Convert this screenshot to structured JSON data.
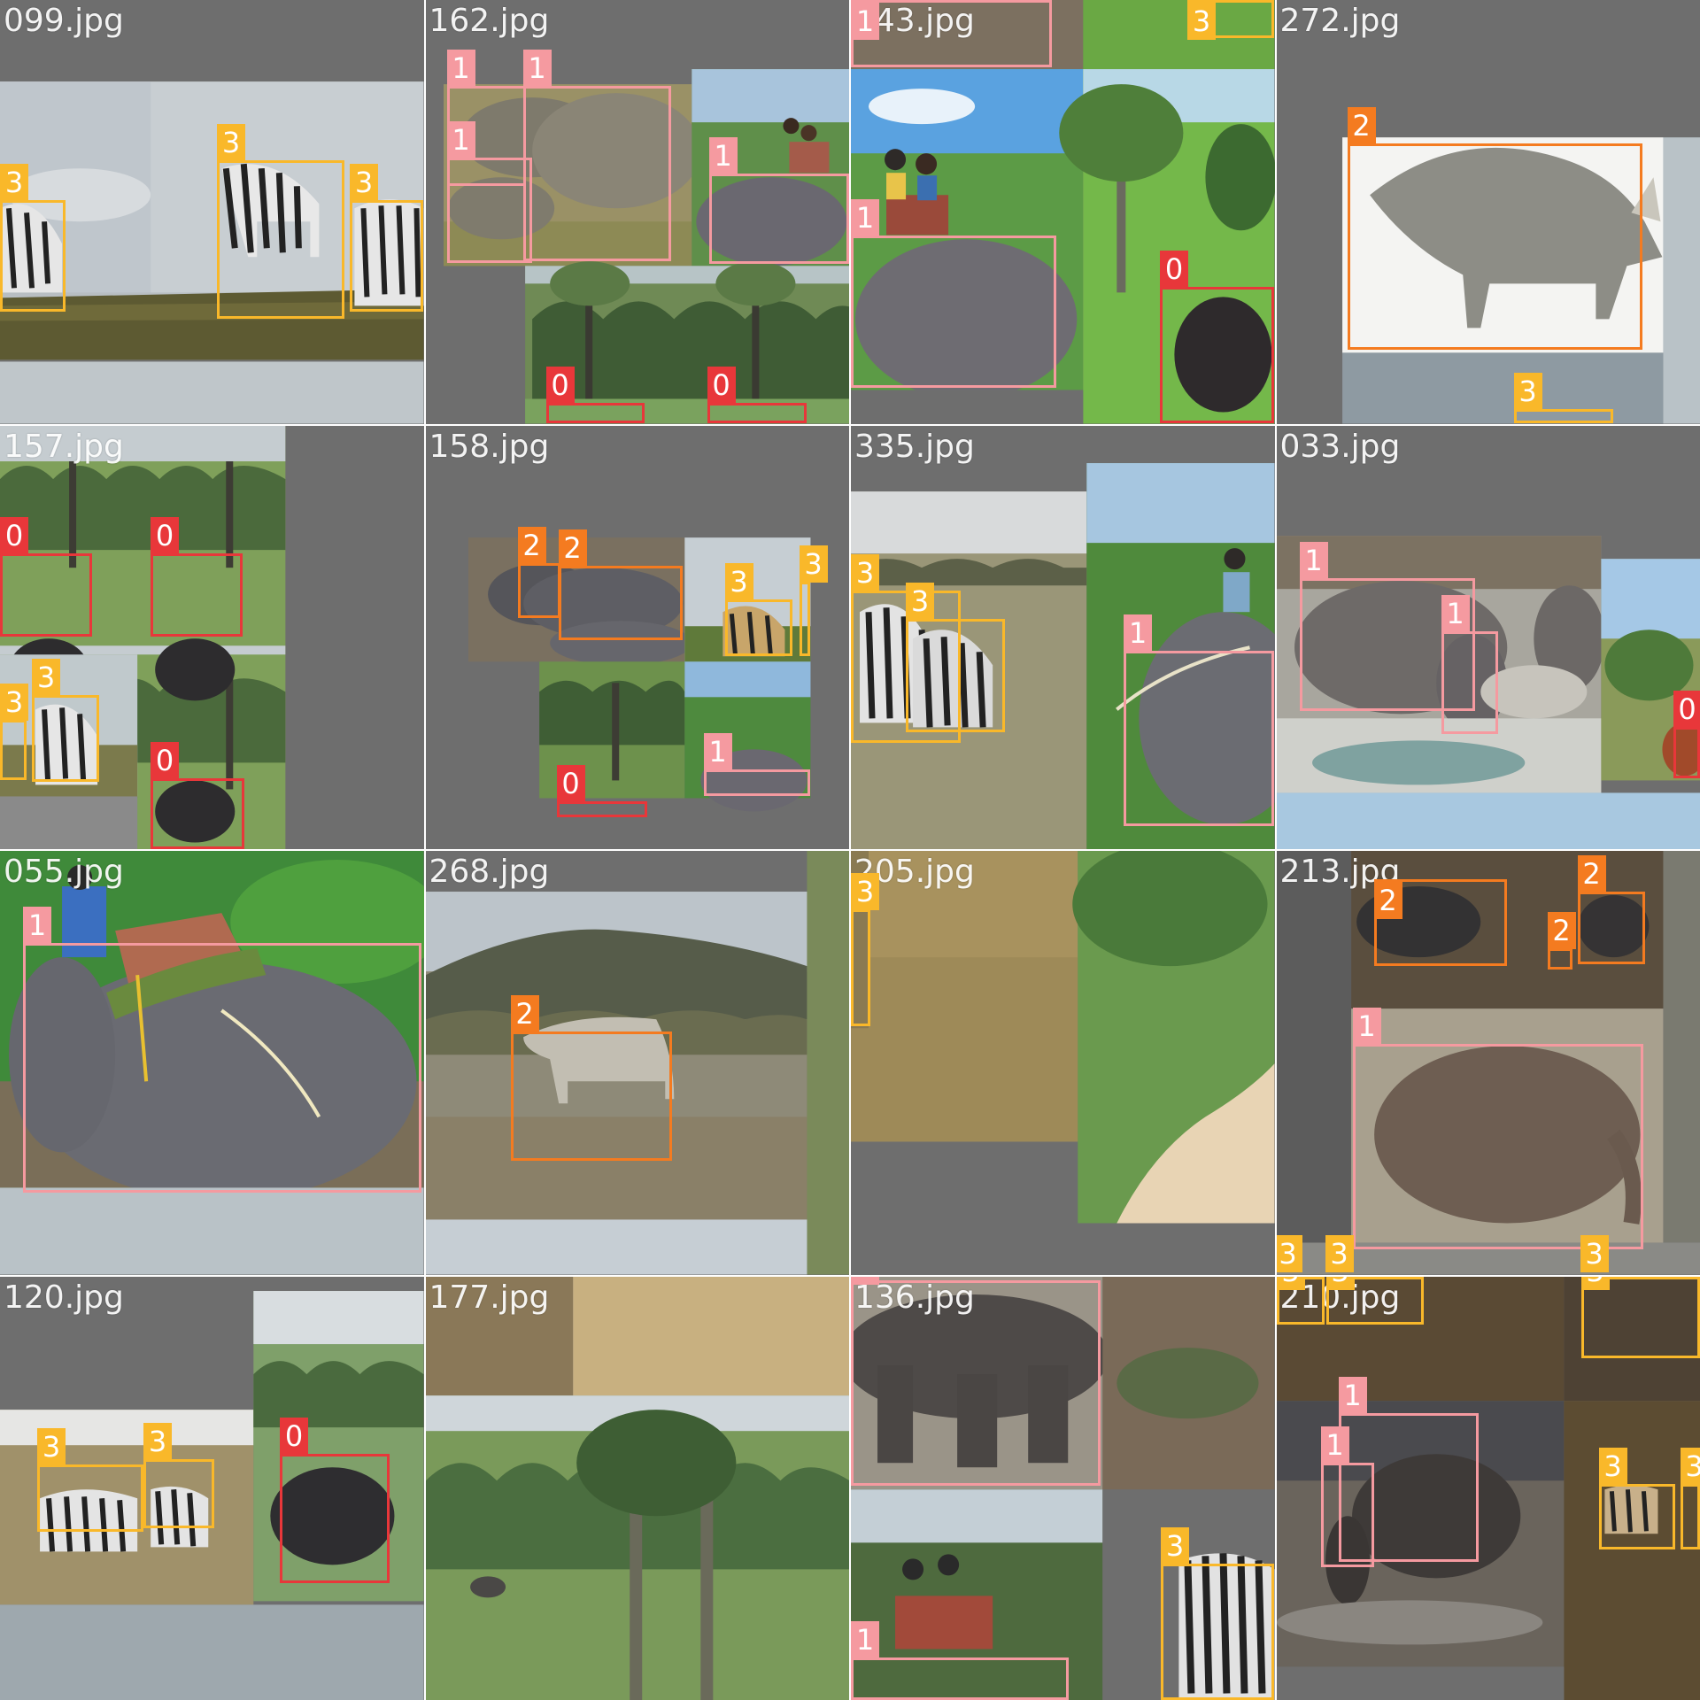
{
  "classes": {
    "0": {
      "color": "#e8373a"
    },
    "1": {
      "color": "#f59aa0"
    },
    "2": {
      "color": "#f47b20"
    },
    "3": {
      "color": "#f9b82a"
    }
  },
  "tiles": [
    {
      "filename": "099.jpg",
      "scene": "zebra-savanna-grey",
      "detections": [
        {
          "label": "3"
        },
        {
          "label": "3"
        },
        {
          "label": "3"
        }
      ]
    },
    {
      "filename": "162.jpg",
      "scene": "elephants-and-palms",
      "detections": [
        {
          "label": "1"
        },
        {
          "label": "1"
        },
        {
          "label": "1"
        },
        {
          "label": "1"
        },
        {
          "label": "0"
        },
        {
          "label": "0"
        }
      ]
    },
    {
      "filename": "143.jpg",
      "scene": "elephant-ride-and-buffalo",
      "detections": [
        {
          "label": "1"
        },
        {
          "label": "3"
        },
        {
          "label": "1"
        },
        {
          "label": "0"
        }
      ]
    },
    {
      "filename": "272.jpg",
      "scene": "black-rhino",
      "detections": [
        {
          "label": "2"
        },
        {
          "label": "3"
        }
      ]
    },
    {
      "filename": "157.jpg",
      "scene": "buffalo-palms-grid",
      "detections": [
        {
          "label": "0"
        },
        {
          "label": "0"
        },
        {
          "label": "3"
        },
        {
          "label": "3"
        },
        {
          "label": "0"
        }
      ]
    },
    {
      "filename": "158.jpg",
      "scene": "rhinos-zebra-small",
      "detections": [
        {
          "label": "2"
        },
        {
          "label": "2"
        },
        {
          "label": "3"
        },
        {
          "label": "3"
        },
        {
          "label": "0"
        },
        {
          "label": "1"
        }
      ]
    },
    {
      "filename": "335.jpg",
      "scene": "zebras-misty-elephant",
      "detections": [
        {
          "label": "3"
        },
        {
          "label": "3"
        },
        {
          "label": "1"
        }
      ]
    },
    {
      "filename": "033.jpg",
      "scene": "zoo-elephants",
      "detections": [
        {
          "label": "1"
        },
        {
          "label": "1"
        },
        {
          "label": "0"
        }
      ]
    },
    {
      "filename": "055.jpg",
      "scene": "elephant-ride-closeup",
      "detections": [
        {
          "label": "1"
        }
      ]
    },
    {
      "filename": "268.jpg",
      "scene": "white-rhino-hills",
      "detections": [
        {
          "label": "2"
        }
      ]
    },
    {
      "filename": "205.jpg",
      "scene": "dry-grass-path",
      "detections": [
        {
          "label": "3"
        }
      ]
    },
    {
      "filename": "213.jpg",
      "scene": "rhinos-and-baby-elephant",
      "detections": [
        {
          "label": "2"
        },
        {
          "label": "2"
        },
        {
          "label": "2"
        },
        {
          "label": "1"
        },
        {
          "label": "3"
        },
        {
          "label": "3"
        },
        {
          "label": "3"
        }
      ]
    },
    {
      "filename": "120.jpg",
      "scene": "zebras-plain-buffalo",
      "detections": [
        {
          "label": "3"
        },
        {
          "label": "3"
        },
        {
          "label": "0"
        }
      ]
    },
    {
      "filename": "177.jpg",
      "scene": "palms-distant-elephant",
      "detections": []
    },
    {
      "filename": "136.jpg",
      "scene": "elephant-legs-zebra",
      "detections": [
        {
          "label": "1"
        },
        {
          "label": "3"
        },
        {
          "label": "1"
        }
      ]
    },
    {
      "filename": "210.jpg",
      "scene": "dark-zoo-elephants-zebras",
      "detections": [
        {
          "label": "3"
        },
        {
          "label": "3"
        },
        {
          "label": "3"
        },
        {
          "label": "1"
        },
        {
          "label": "1"
        },
        {
          "label": "3"
        },
        {
          "label": "3"
        }
      ]
    }
  ]
}
